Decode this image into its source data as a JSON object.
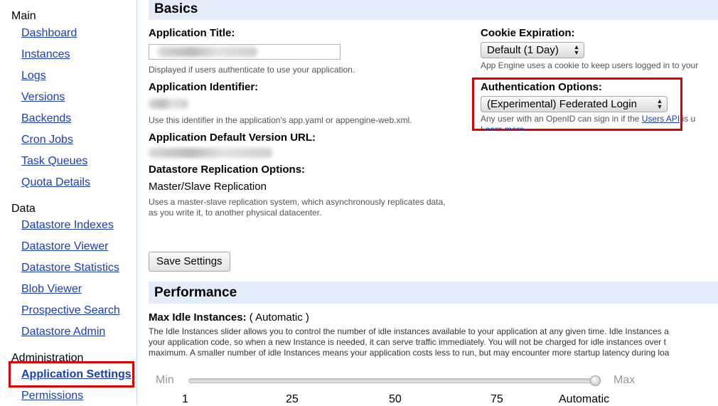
{
  "sidebar": {
    "sections": [
      {
        "title": "Main",
        "items": [
          "Dashboard",
          "Instances",
          "Logs",
          "Versions",
          "Backends",
          "Cron Jobs",
          "Task Queues",
          "Quota Details"
        ]
      },
      {
        "title": "Data",
        "items": [
          "Datastore Indexes",
          "Datastore Viewer",
          "Datastore Statistics",
          "Blob Viewer",
          "Prospective Search",
          "Datastore Admin"
        ]
      },
      {
        "title": "Administration",
        "items": [
          "Application Settings",
          "Permissions"
        ]
      }
    ],
    "active_item": "Application Settings"
  },
  "basics": {
    "title": "Basics",
    "app_title_label": "Application Title:",
    "app_title_help": "Displayed if users authenticate to use your application.",
    "app_id_label": "Application Identifier:",
    "app_id_help": "Use this identifier in the application's app.yaml or appengine-web.xml.",
    "default_url_label": "Application Default Version URL:",
    "replication_label": "Datastore Replication Options:",
    "replication_value": "Master/Slave Replication",
    "replication_help_1": "Uses a master-slave replication system, which asynchronously replicates data,",
    "replication_help_2": "as you write it, to another physical datacenter.",
    "cookie_label": "Cookie Expiration:",
    "cookie_value": "Default (1 Day)",
    "cookie_help": "App Engine uses a cookie to keep users logged in to your",
    "auth_label": "Authentication Options:",
    "auth_value": "(Experimental) Federated Login",
    "auth_help_prefix": "Any user with an OpenID can sign in if the ",
    "auth_help_link": "Users API",
    "auth_help_suffix": " is u",
    "learn_more": "Learn more",
    "save_button": "Save Settings"
  },
  "performance": {
    "title": "Performance",
    "idle_label": "Max Idle Instances:",
    "idle_value": "( Automatic )",
    "desc_1": "The Idle Instances slider allows you to control the number of idle instances available to your application at any given time. Idle Instances a",
    "desc_2": "your application code, so when a new Instance is needed, it can serve traffic immediately. You will not be charged for idle instances over t",
    "desc_3": "maximum. A smaller number of idle Instances means your application costs less to run, but may encounter more startup latency during loa",
    "slider_min": "Min",
    "slider_max": "Max",
    "slider_value_fraction": 1.0,
    "ticks": [
      "1",
      "25",
      "50",
      "75",
      "Automatic"
    ]
  },
  "colors": {
    "link": "#1a3dc1",
    "section_bar": "#e5ecf9",
    "highlight": "#e00000"
  }
}
